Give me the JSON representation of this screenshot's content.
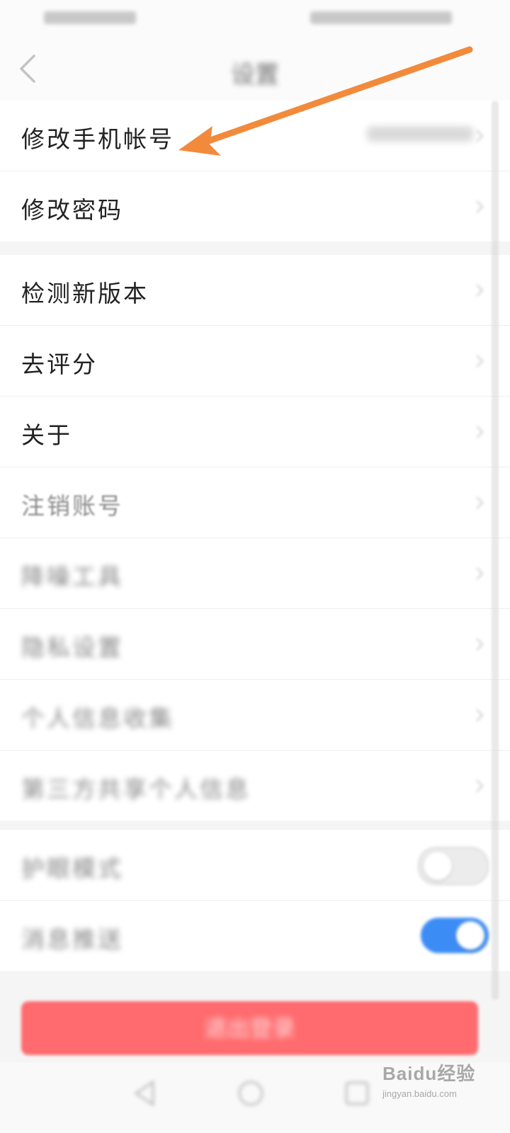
{
  "navbar": {
    "title": "设置"
  },
  "account_group": [
    {
      "label": "修改手机帐号",
      "value": "137****3589"
    },
    {
      "label": "修改密码"
    }
  ],
  "general_group": [
    {
      "label": "检测新版本"
    },
    {
      "label": "去评分"
    },
    {
      "label": "关于"
    },
    {
      "label": "注销账号"
    },
    {
      "label": "降噪工具"
    },
    {
      "label": "隐私设置"
    },
    {
      "label": "个人信息收集"
    },
    {
      "label": "第三方共享个人信息"
    }
  ],
  "toggle_group": [
    {
      "label": "护眼模式",
      "enabled": false
    },
    {
      "label": "消息推送",
      "enabled": true
    }
  ],
  "logout_label": "退出登录",
  "watermark": {
    "logo": "Baidu经验",
    "sub": "jingyan.baidu.com"
  },
  "colors": {
    "annotation_arrow": "#f28a3c",
    "logout_button": "#ff6b6e",
    "toggle_on": "#3c8cf5"
  }
}
